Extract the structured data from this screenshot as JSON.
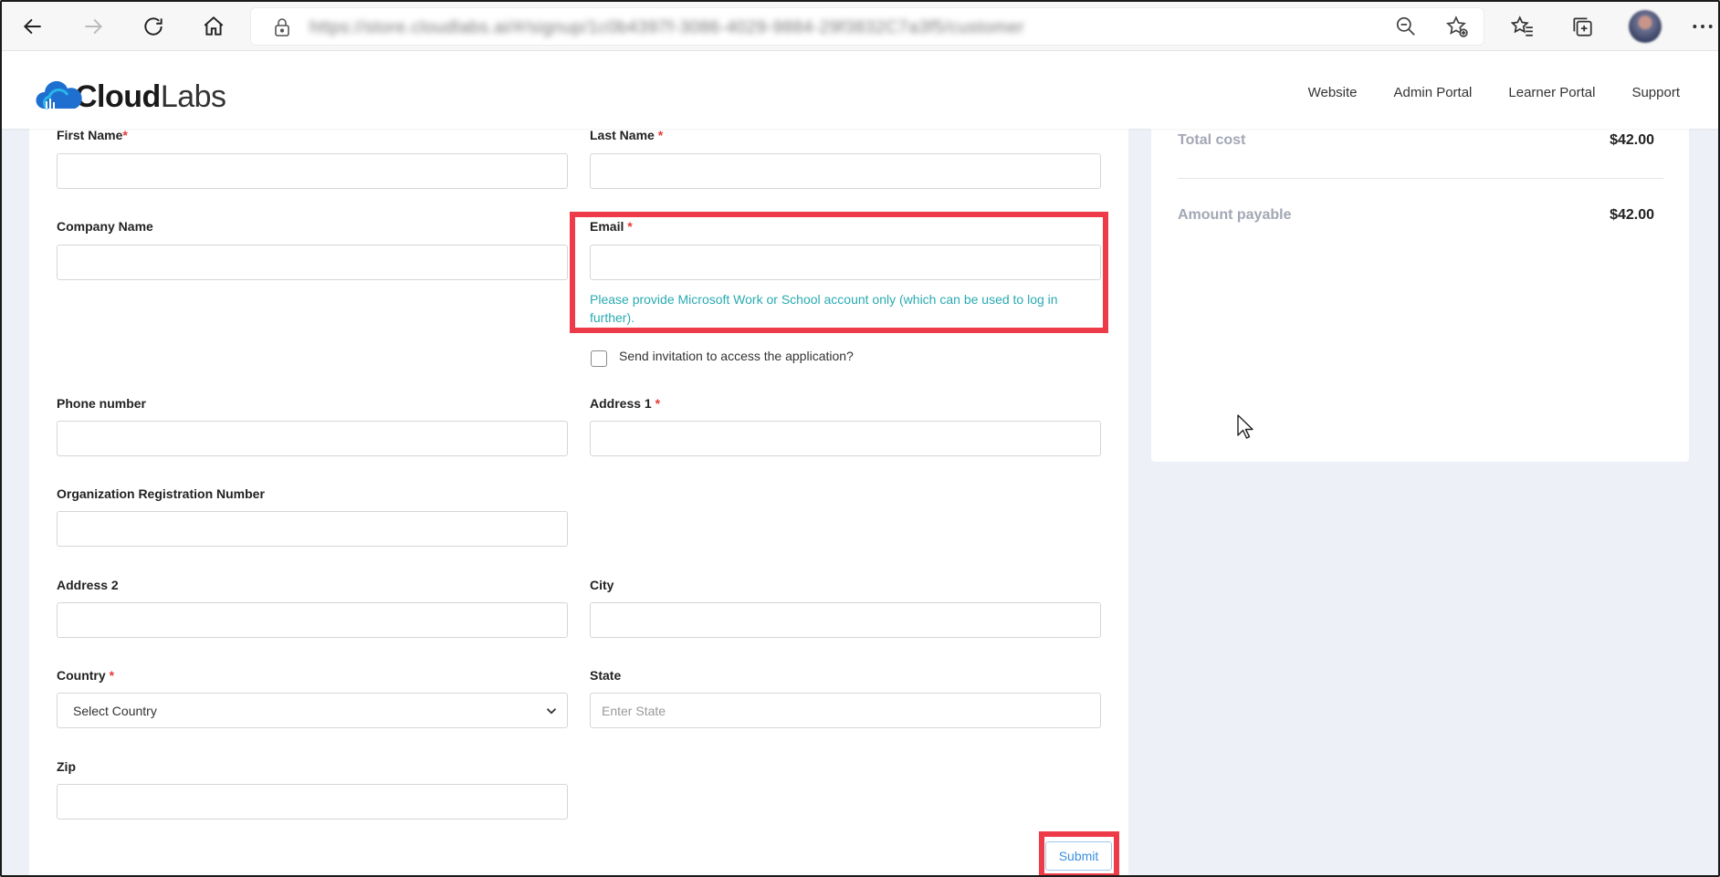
{
  "browser": {
    "url": "https://store.cloudlabs.ai/#/signup/1c0b4397f-3086-4029-9884-29f3832C7a3f5/customer"
  },
  "brand": {
    "logo_bold": "Cloud",
    "logo_light": "Labs",
    "accent_color": "#2aaab2",
    "highlight_color": "#ee3b4a"
  },
  "nav": {
    "items": [
      "Website",
      "Admin Portal",
      "Learner Portal",
      "Support"
    ]
  },
  "form": {
    "first_name": {
      "label": "First Name",
      "required_mark": "*",
      "value": ""
    },
    "last_name": {
      "label": "Last Name",
      "required_mark": "*",
      "value": ""
    },
    "company_name": {
      "label": "Company Name",
      "value": ""
    },
    "email": {
      "label": "Email",
      "required_mark": "*",
      "value": "",
      "hint": "Please provide Microsoft Work or School account only (which can be used to log in further)."
    },
    "send_invitation": {
      "label": "Send invitation to access the application?",
      "checked": false
    },
    "phone_number": {
      "label": "Phone number",
      "value": ""
    },
    "address1": {
      "label": "Address 1",
      "required_mark": "*",
      "value": ""
    },
    "org_reg_number": {
      "label": "Organization Registration Number",
      "value": ""
    },
    "address2": {
      "label": "Address 2",
      "value": ""
    },
    "city": {
      "label": "City",
      "value": ""
    },
    "country": {
      "label": "Country",
      "required_mark": "*",
      "selected": "Select Country"
    },
    "state": {
      "label": "State",
      "placeholder": "Enter State",
      "value": ""
    },
    "zip": {
      "label": "Zip",
      "value": ""
    },
    "submit_label": "Submit"
  },
  "summary": {
    "total_cost_label": "Total cost",
    "total_cost_value": "$42.00",
    "amount_payable_label": "Amount payable",
    "amount_payable_value": "$42.00"
  }
}
